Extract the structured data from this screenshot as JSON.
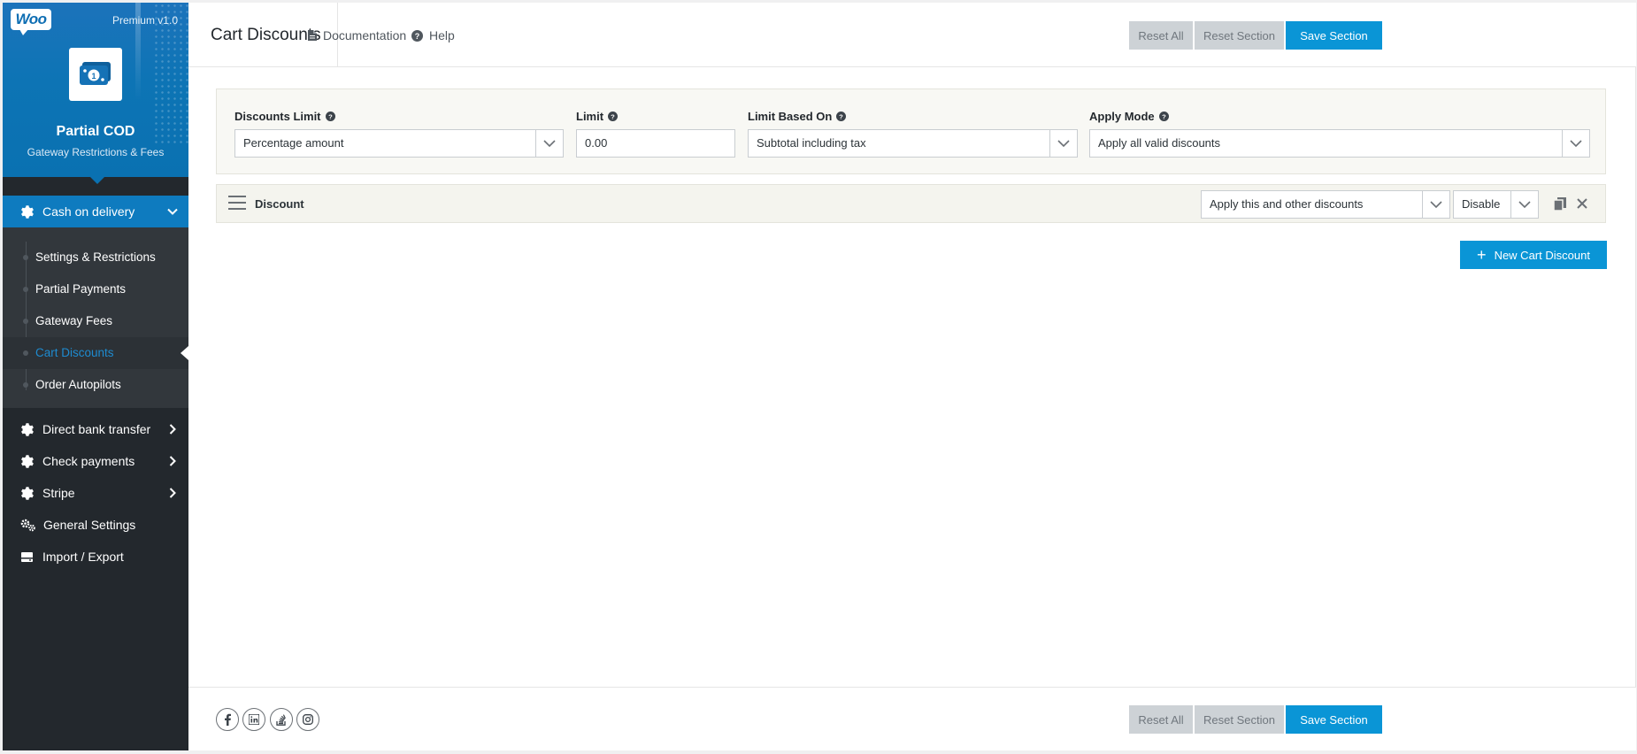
{
  "brand": {
    "logo_text": "Woo",
    "version": "Premium v1.0",
    "app_title": "Partial COD",
    "app_subtitle": "Gateway Restrictions & Fees"
  },
  "sidebar": {
    "active_group": "Cash on delivery",
    "submenu": [
      "Settings & Restrictions",
      "Partial Payments",
      "Gateway Fees",
      "Cart Discounts",
      "Order Autopilots"
    ],
    "groups": [
      "Direct bank transfer",
      "Check payments",
      "Stripe",
      "General Settings",
      "Import / Export"
    ]
  },
  "header": {
    "title": "Cart Discounts",
    "documentation": "Documentation",
    "help": "Help",
    "reset_all": "Reset All",
    "reset_section": "Reset Section",
    "save_section": "Save Section"
  },
  "filters": {
    "discounts_limit_label": "Discounts Limit",
    "discounts_limit_value": "Percentage amount",
    "limit_label": "Limit",
    "limit_value": "0.00",
    "limit_based_on_label": "Limit Based On",
    "limit_based_on_value": "Subtotal including tax",
    "apply_mode_label": "Apply Mode",
    "apply_mode_value": "Apply all valid discounts"
  },
  "discount": {
    "label": "Discount",
    "mode_value": "Apply this and other discounts",
    "status_value": "Disable"
  },
  "actions": {
    "new_cart_discount": "New Cart Discount"
  },
  "footer": {
    "reset_all": "Reset All",
    "reset_section": "Reset Section",
    "save_section": "Save Section"
  },
  "colors": {
    "accent": "#0a95d6",
    "sidebar_bg": "#23282d",
    "active_nav": "#0e7bbf"
  }
}
